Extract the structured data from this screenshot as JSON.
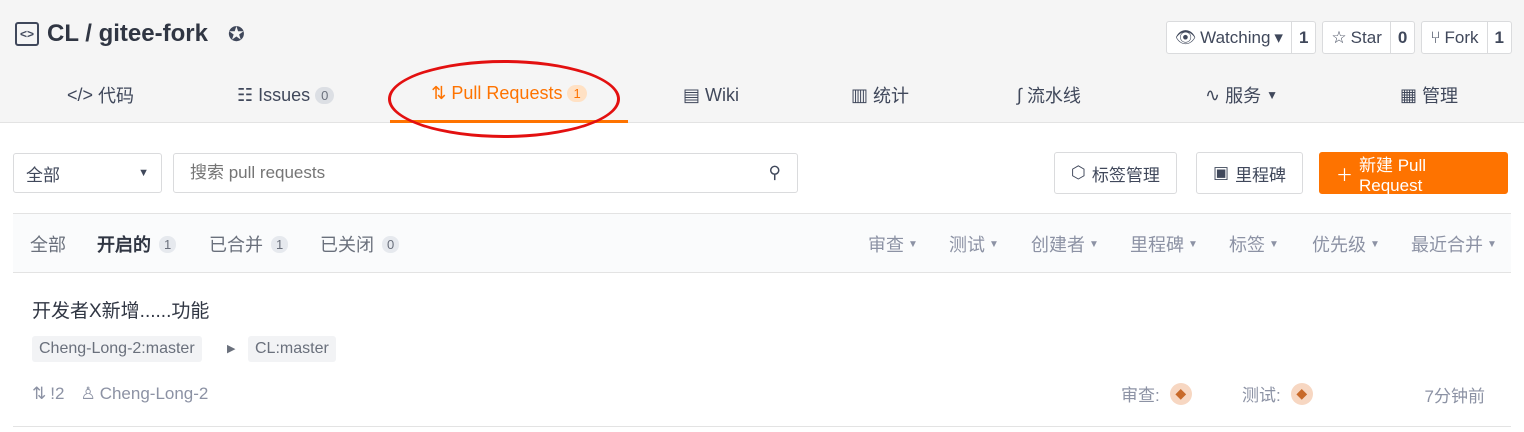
{
  "repo": {
    "owner": "CL",
    "separator": "/",
    "name": "gitee-fork"
  },
  "actions": [
    {
      "label": "Watching",
      "count": "1",
      "icon": "eye-icon",
      "caret": "▾"
    },
    {
      "label": "Star",
      "count": "0",
      "icon": "star-icon"
    },
    {
      "label": "Fork",
      "count": "1",
      "icon": "fork-icon"
    }
  ],
  "tabs": {
    "code": {
      "label": "代码",
      "icon": "code-icon"
    },
    "issues": {
      "label": "Issues",
      "count": "0",
      "icon": "issues-icon"
    },
    "pulls": {
      "label": "Pull Requests",
      "count": "1",
      "icon": "pull-request-icon"
    },
    "wiki": {
      "label": "Wiki",
      "icon": "book-icon"
    },
    "stats": {
      "label": "统计",
      "icon": "chart-icon"
    },
    "pipeline": {
      "label": "流水线",
      "icon": "pipeline-icon"
    },
    "services": {
      "label": "服务",
      "icon": "pulse-icon"
    },
    "manage": {
      "label": "管理",
      "icon": "settings-doc-icon"
    }
  },
  "toolbar": {
    "scope": "全部",
    "search_placeholder": "搜索 pull requests",
    "labels_button": "标签管理",
    "milestones_button": "里程碑",
    "new_button": "新建 Pull Request"
  },
  "filters": {
    "all": "全部",
    "open": {
      "label": "开启的",
      "count": "1"
    },
    "merged": {
      "label": "已合并",
      "count": "1"
    },
    "closed": {
      "label": "已关闭",
      "count": "0"
    },
    "dropdowns": [
      "审查",
      "测试",
      "创建者",
      "里程碑",
      "标签",
      "优先级",
      "最近合并"
    ]
  },
  "pr": {
    "title": "开发者X新增......功能",
    "source_branch": "Cheng-Long-2:master",
    "target_branch": "CL:master",
    "number": "!2",
    "author": "Cheng-Long-2",
    "reviewer_label": "审查:",
    "tester_label": "测试:",
    "time": "7分钟前"
  },
  "colors": {
    "accent": "#fe7300",
    "annotation": "#e31010"
  }
}
